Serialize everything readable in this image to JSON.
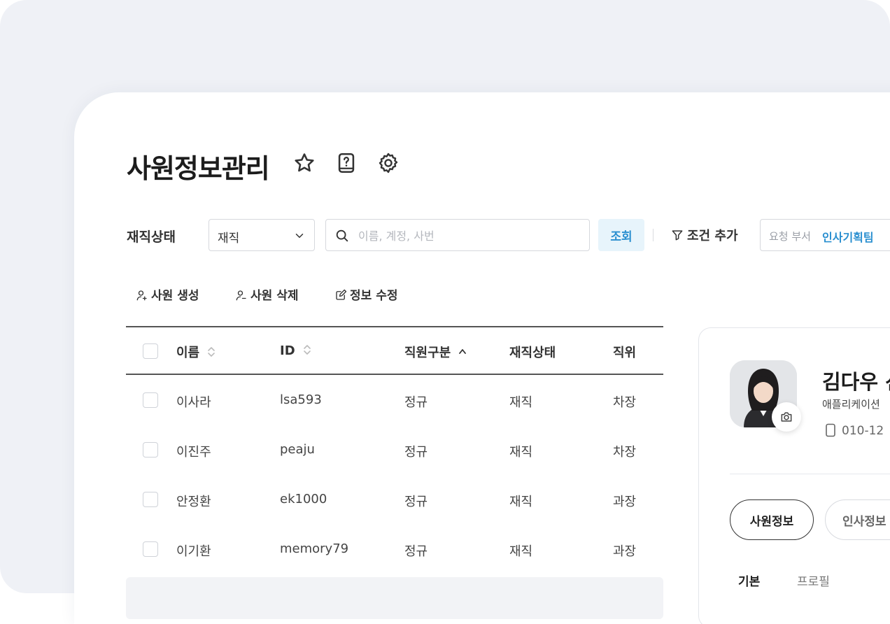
{
  "page": {
    "title": "사원정보관리"
  },
  "filters": {
    "status_label": "재직상태",
    "status_value": "재직",
    "search_placeholder": "이름, 계정, 사번",
    "search_button": "조회",
    "add_condition": "조건 추가",
    "dept_label": "요청 부서",
    "dept_value": "인사기획팀"
  },
  "actions": {
    "create": "사원 생성",
    "delete": "사원 삭제",
    "edit": "정보 수정"
  },
  "table": {
    "headers": [
      "이름",
      "ID",
      "직원구분",
      "재직상태",
      "직위"
    ],
    "rows": [
      [
        "이사라",
        "lsa593",
        "정규",
        "재직",
        "차장"
      ],
      [
        "이진주",
        "peaju",
        "정규",
        "재직",
        "차장"
      ],
      [
        "안정환",
        "ek1000",
        "정규",
        "재직",
        "과장"
      ],
      [
        "이기환",
        "memory79",
        "정규",
        "재직",
        "과장"
      ]
    ]
  },
  "profile": {
    "name": "김다우 선",
    "dept": "애플리케이션",
    "phone": "010-12",
    "tabs": [
      "사원정보",
      "인사정보"
    ],
    "subtabs": [
      "기본",
      "프로필"
    ]
  },
  "colors": {
    "accent": "#2a8fd0",
    "accent_bg": "#e7f4fb",
    "page_bg": "#eff1f6"
  }
}
